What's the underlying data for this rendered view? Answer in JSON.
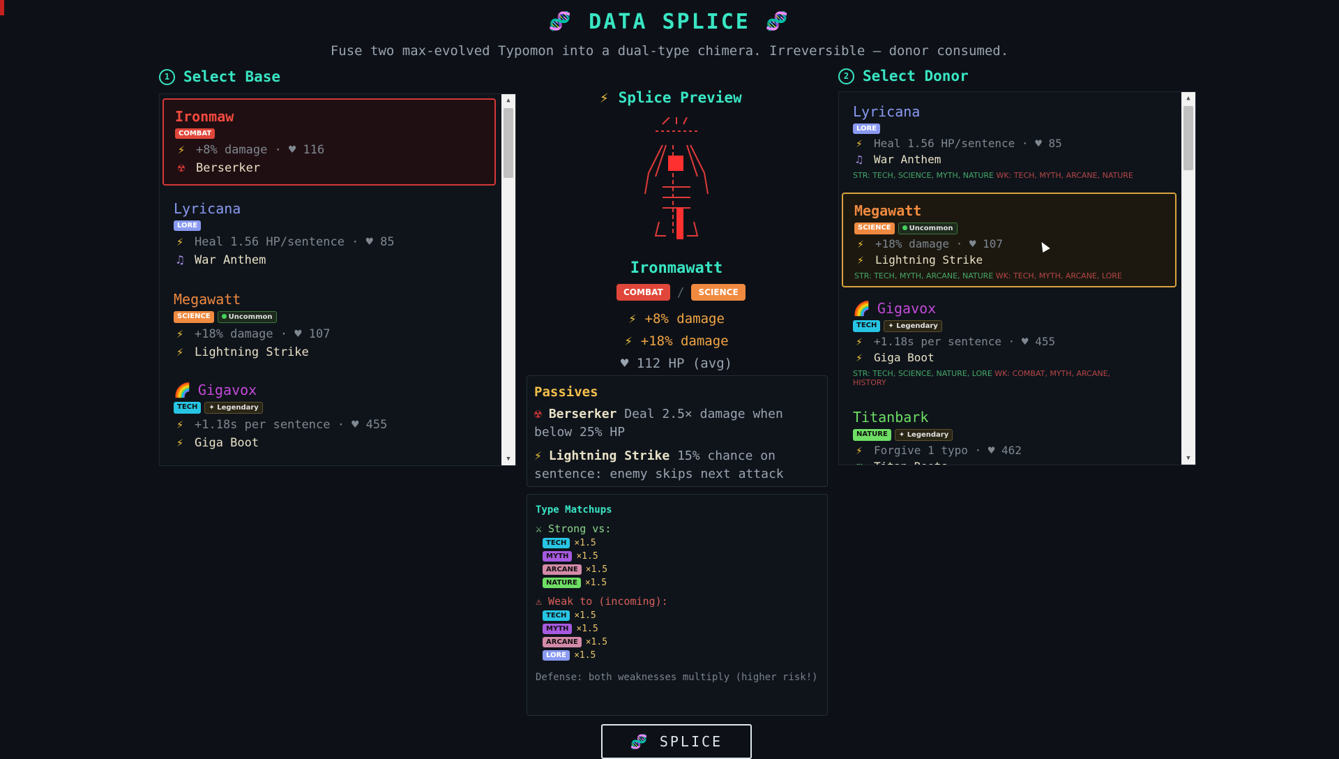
{
  "header": {
    "title": "DATA SPLICE",
    "subtitle": "Fuse two max-evolved Typomon into a dual-type chimera. Irreversible — donor consumed."
  },
  "base": {
    "heading": "Select Base",
    "step": "1",
    "cards": [
      {
        "name": "Ironmaw",
        "type": "COMBAT",
        "stat": "+8% damage · ♥ 116",
        "skill": "Berserker",
        "selected": true
      },
      {
        "name": "Lyricana",
        "type": "LORE",
        "stat": "Heal 1.56 HP/sentence · ♥ 85",
        "skill": "War Anthem"
      },
      {
        "name": "Megawatt",
        "type": "SCIENCE",
        "rarity": "Uncommon",
        "stat": "+18% damage · ♥ 107",
        "skill": "Lightning Strike"
      },
      {
        "name": "Gigavox",
        "type": "TECH",
        "rarity": "Legendary",
        "stat": "+1.18s per sentence · ♥ 455",
        "skill": "Giga Boot"
      }
    ]
  },
  "donor": {
    "heading": "Select Donor",
    "step": "2",
    "cards": [
      {
        "name": "Lyricana",
        "type": "LORE",
        "stat": "Heal 1.56 HP/sentence · ♥ 85",
        "skill": "War Anthem",
        "str": "STR: TECH, SCIENCE, MYTH, NATURE",
        "wk": "WK: TECH, MYTH, ARCANE, NATURE"
      },
      {
        "name": "Megawatt",
        "type": "SCIENCE",
        "rarity": "Uncommon",
        "stat": "+18% damage · ♥ 107",
        "skill": "Lightning Strike",
        "str": "STR: TECH, MYTH, ARCANE, NATURE",
        "wk": "WK: TECH, MYTH, ARCANE, LORE",
        "selected": true
      },
      {
        "name": "Gigavox",
        "type": "TECH",
        "rarity": "Legendary",
        "stat": "+1.18s per sentence · ♥ 455",
        "skill": "Giga Boot",
        "str": "STR: TECH, SCIENCE, NATURE, LORE",
        "wk": "WK: COMBAT, MYTH, ARCANE,",
        "wk2": "HISTORY"
      },
      {
        "name": "Titanbark",
        "type": "NATURE",
        "rarity": "Legendary",
        "stat": "Forgive 1 typo · ♥ 462",
        "skill": "Titan Roots"
      }
    ]
  },
  "preview": {
    "heading": "Splice Preview",
    "name": "Ironmawatt",
    "type1": "COMBAT",
    "type2": "SCIENCE",
    "effect1": "+8% damage",
    "effect2": "+18% damage",
    "hp": "♥ 112 HP (avg)",
    "passives_title": "Passives",
    "passives": [
      {
        "name": "Berserker",
        "desc": "Deal 2.5× damage when below 25% HP"
      },
      {
        "name": "Lightning Strike",
        "desc": "15% chance on sentence: enemy skips next attack"
      }
    ],
    "matchups_title": "Type Matchups",
    "strong_label": "⚔ Strong vs:",
    "strong": [
      {
        "type": "TECH",
        "mult": "×1.5"
      },
      {
        "type": "MYTH",
        "mult": "×1.5"
      },
      {
        "type": "ARCANE",
        "mult": "×1.5"
      },
      {
        "type": "NATURE",
        "mult": "×1.5"
      }
    ],
    "weak_label": "⚠ Weak to (incoming):",
    "weak": [
      {
        "type": "TECH",
        "mult": "×1.5"
      },
      {
        "type": "MYTH",
        "mult": "×1.5"
      },
      {
        "type": "ARCANE",
        "mult": "×1.5"
      },
      {
        "type": "LORE",
        "mult": "×1.5"
      }
    ],
    "defense_note": "Defense: both weaknesses multiply (higher risk!)"
  },
  "splice_button": "SPLICE",
  "colors": {
    "accent": "#39e6c4",
    "base_sel": "#d63838",
    "donor_sel": "#d9a23f"
  }
}
